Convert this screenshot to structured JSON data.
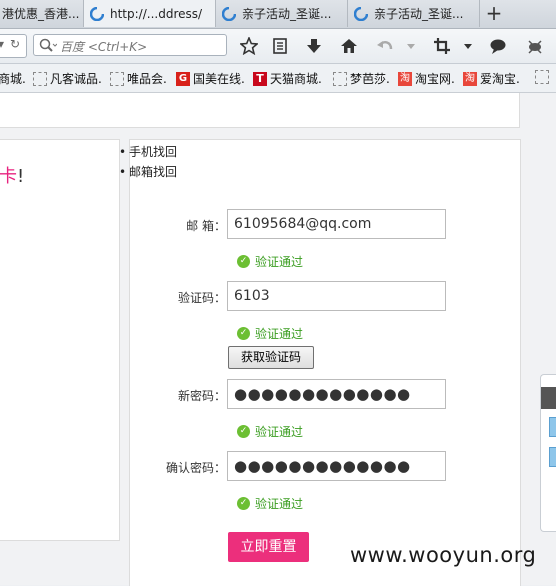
{
  "tabs": [
    {
      "label": "港优惠_香港..."
    },
    {
      "label": "http://...ddress/"
    },
    {
      "label": "亲子活动_圣诞..."
    },
    {
      "label": "亲子活动_圣诞..."
    }
  ],
  "new_tab": "+",
  "search": {
    "placeholder": "百度 <Ctrl+K>"
  },
  "bookmarks": [
    {
      "label": "商城."
    },
    {
      "label": "凡客诚品."
    },
    {
      "label": "唯品会."
    },
    {
      "label": "国美在线."
    },
    {
      "label": "天猫商城."
    },
    {
      "label": "梦芭莎."
    },
    {
      "label": "淘宝网."
    },
    {
      "label": "爱淘宝."
    }
  ],
  "page": {
    "headline_pink": "卡",
    "headline_mark": "!",
    "methods": [
      "手机找回",
      "邮箱找回"
    ],
    "form": {
      "email_label": "邮 箱：",
      "email_value": "61095684@qq.com",
      "code_label": "验证码：",
      "code_value": "6103",
      "get_code_button": "获取验证码",
      "new_pw_label": "新密码：",
      "new_pw_value": "●●●●●●●●●●●●●",
      "confirm_pw_label": "确认密码：",
      "confirm_pw_value": "●●●●●●●●●●●●●",
      "ok_text": "验证通过",
      "submit_button": "立即重置"
    }
  },
  "watermark": "www.wooyun.org",
  "colors": {
    "accent": "#ec2f7c",
    "ok": "#3a9d20"
  }
}
